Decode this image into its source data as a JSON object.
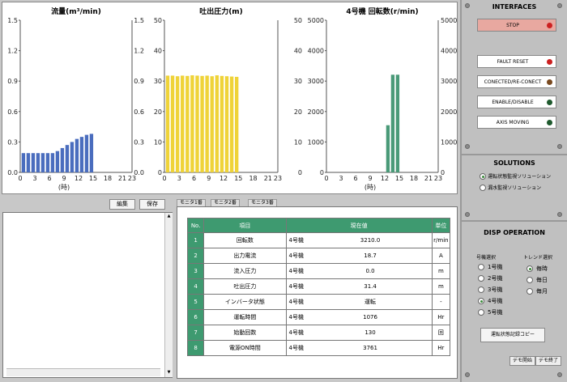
{
  "colors": {
    "flow": "#4a6dbe",
    "pressure": "#efd338",
    "rpm": "#4a9a78",
    "header_green": "#3e9a70"
  },
  "chart_data": [
    {
      "type": "bar",
      "title": "流量(m³/min)",
      "xlabel": "(時)",
      "x": [
        0,
        1,
        2,
        3,
        4,
        5,
        6,
        7,
        8,
        9,
        10,
        11,
        12,
        13,
        14
      ],
      "values": [
        0.19,
        0.19,
        0.19,
        0.19,
        0.19,
        0.19,
        0.19,
        0.21,
        0.24,
        0.27,
        0.3,
        0.33,
        0.35,
        0.37,
        0.38
      ],
      "ylim": [
        0,
        1.5
      ],
      "yticks": [
        "0.0",
        "0.3",
        "0.6",
        "0.9",
        "1.2",
        "1.5"
      ],
      "xticks": [
        "0",
        "3",
        "6",
        "9",
        "12",
        "15",
        "18",
        "21",
        "23"
      ],
      "color_key": "flow"
    },
    {
      "type": "bar",
      "title": "吐出圧力(m)",
      "xlabel": "",
      "x": [
        0,
        1,
        2,
        3,
        4,
        5,
        6,
        7,
        8,
        9,
        10,
        11,
        12,
        13,
        14
      ],
      "values": [
        31.8,
        31.8,
        31.6,
        31.8,
        31.7,
        31.9,
        31.8,
        31.7,
        31.8,
        31.6,
        31.9,
        31.7,
        31.6,
        31.5,
        31.4
      ],
      "ylim": [
        0,
        50
      ],
      "yticks": [
        "0",
        "10",
        "20",
        "30",
        "40",
        "50"
      ],
      "xticks": [
        "0",
        "3",
        "6",
        "9",
        "12",
        "15",
        "18",
        "21",
        "23"
      ],
      "left_ticks": [
        "0.0",
        "0.3",
        "0.6",
        "0.9",
        "1.2",
        "1.5"
      ],
      "color_key": "pressure"
    },
    {
      "type": "bar",
      "title": "4号機 回転数(r/min)",
      "xlabel": "(時)",
      "x": [
        12,
        13,
        14
      ],
      "values": [
        1550,
        3210,
        3210
      ],
      "ylim": [
        0,
        5000
      ],
      "yticks": [
        "0",
        "1000",
        "2000",
        "3000",
        "4000",
        "5000"
      ],
      "xticks": [
        "0",
        "3",
        "6",
        "9",
        "12",
        "15",
        "18",
        "21",
        "23"
      ],
      "color_key": "rpm"
    }
  ],
  "toolbar": {
    "edit": "編集",
    "save": "保存"
  },
  "tabs": [
    "モニタ1番",
    "モニタ2番",
    "モニタ3番"
  ],
  "table": {
    "headers": [
      "No.",
      "項目",
      "現在値",
      "単位"
    ],
    "rows": [
      {
        "no": "1",
        "item": "回転数",
        "unit_name": "4号機",
        "value": "3210.0",
        "unit": "r/min"
      },
      {
        "no": "2",
        "item": "出力電流",
        "unit_name": "4号機",
        "value": "18.7",
        "unit": "A"
      },
      {
        "no": "3",
        "item": "流入圧力",
        "unit_name": "4号機",
        "value": "0.0",
        "unit": "m"
      },
      {
        "no": "4",
        "item": "吐出圧力",
        "unit_name": "4号機",
        "value": "31.4",
        "unit": "m"
      },
      {
        "no": "5",
        "item": "インバータ状態",
        "unit_name": "4号機",
        "value": "運転",
        "unit": "-"
      },
      {
        "no": "6",
        "item": "運転時間",
        "unit_name": "4号機",
        "value": "1076",
        "unit": "Hr"
      },
      {
        "no": "7",
        "item": "始動回数",
        "unit_name": "4号機",
        "value": "130",
        "unit": "回"
      },
      {
        "no": "8",
        "item": "電源ON時間",
        "unit_name": "4号機",
        "value": "3761",
        "unit": "Hr"
      }
    ]
  },
  "interfaces": {
    "title": "INTERFACES",
    "stop": "STOP",
    "fault_reset": "FAULT RESET",
    "connect": "CONECTED/RE-CONECT",
    "enable": "ENABLE/DISABLE",
    "axis_moving": "AXIS MOVING",
    "lamps": {
      "stop": "#cc2020",
      "fault_reset": "#cc2020",
      "connect": "#7a4a20",
      "enable": "#1f5a2e",
      "axis_moving": "#1f5a2e"
    }
  },
  "solutions": {
    "title": "SOLUTIONS",
    "options": [
      "運転状態監視ソリューション",
      "漏水監視ソリューション"
    ],
    "selected": 0
  },
  "disp": {
    "title": "DISP OPERATION",
    "unit_select_label": "号機選択",
    "trend_select_label": "トレンド選択",
    "units": [
      "1号機",
      "2号機",
      "3号機",
      "4号機",
      "5号機"
    ],
    "unit_selected": 3,
    "trends": [
      "毎時",
      "毎日",
      "毎月"
    ],
    "trend_selected": 0,
    "copy_button": "運転状態記録コピー",
    "demo_start": "デモ開始",
    "demo_end": "デモ終了"
  }
}
